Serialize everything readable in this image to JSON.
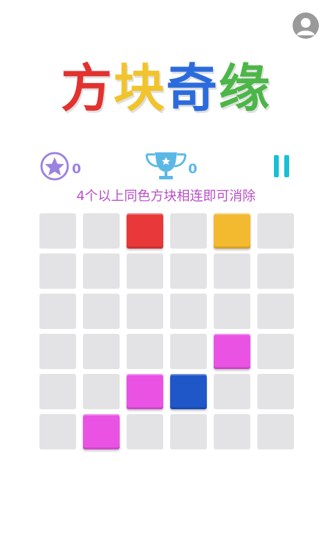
{
  "header": {
    "profile_icon": "user-avatar-icon"
  },
  "title": {
    "chars": [
      {
        "text": "方",
        "color": "#e23230"
      },
      {
        "text": "块",
        "color": "#f1c42d"
      },
      {
        "text": "奇",
        "color": "#2b6bdc"
      },
      {
        "text": "缘",
        "color": "#4cb648"
      }
    ]
  },
  "stats": {
    "stars_icon": "star-badge-icon",
    "stars_value": "0",
    "trophy_icon": "trophy-icon",
    "trophy_value": "0",
    "pause_icon": "pause-icon"
  },
  "hint": "4个以上同色方块相连即可消除",
  "colors": {
    "red": "#e8383a",
    "yellow": "#f3b92f",
    "magenta": "#ea52e4",
    "blue": "#1f56c8",
    "empty": "#e3e3e6",
    "hint": "#b84fc6",
    "stars": "#9b82e0",
    "trophy": "#5bb8e6",
    "pause": "#17c0d6"
  },
  "board": {
    "rows": 6,
    "cols": 6,
    "cells": [
      [
        "",
        "",
        "red",
        "",
        "yellow",
        ""
      ],
      [
        "",
        "",
        "",
        "",
        "",
        ""
      ],
      [
        "",
        "",
        "",
        "",
        "",
        ""
      ],
      [
        "",
        "",
        "",
        "",
        "magenta",
        ""
      ],
      [
        "",
        "",
        "magenta",
        "blue",
        "",
        ""
      ],
      [
        "",
        "magenta",
        "",
        "",
        "",
        ""
      ]
    ]
  }
}
